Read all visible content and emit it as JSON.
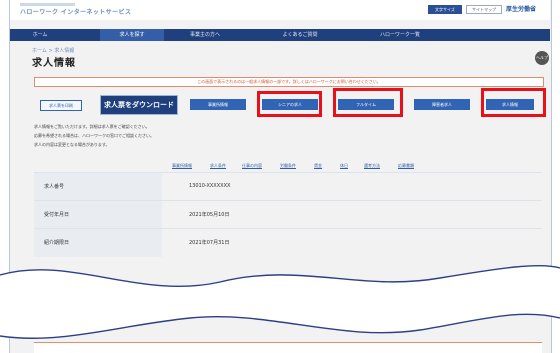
{
  "header": {
    "logo_text": "ハローワーク インターネットサービス",
    "btn_dark": "文字サイズ",
    "btn_light": "サイトマップ",
    "hdr_logo": "厚生労働省"
  },
  "nav": {
    "items": [
      "ホーム",
      "求人を探す",
      "事業主の方へ",
      "よくあるご質問",
      "ハローワーク一覧"
    ]
  },
  "breadcrumb": "ホーム > 求人情報",
  "page_title": "求人情報",
  "help_label": "ヘルプ",
  "notice": "この画面で表示されるのは一般求人情報の一部です。詳しくはハローワークにお問い合わせください。",
  "tabs": {
    "t1": "求人票を印刷",
    "main": "求人票をダウンロード",
    "t3": "事業所情報",
    "t4": "シニアの求人",
    "t5": "フルタイム",
    "t6": "障害者求人",
    "t7": "求人情報"
  },
  "description": [
    "求人情報をご覧いただけます。詳細は求人票をご確認ください。",
    "応募を希望される場合は、ハローワークの窓口でご相談ください。",
    "求人の内容は変更となる場合があります。"
  ],
  "links": [
    "事業所情報",
    "求人条件",
    "仕事の内容",
    "労働条件",
    "賃金",
    "休日",
    "選考方法",
    "応募書類"
  ],
  "table": {
    "rows": [
      {
        "label": "求人番号",
        "value": "13010-XXXXXXX"
      },
      {
        "label": "受付年月日",
        "value": "2021年05月10日"
      },
      {
        "label": "紹介期限日",
        "value": "2021年07月31日"
      }
    ]
  },
  "colors": {
    "highlight": "#e8101a",
    "nav": "#1f3f7d",
    "accent": "#3164b4"
  }
}
